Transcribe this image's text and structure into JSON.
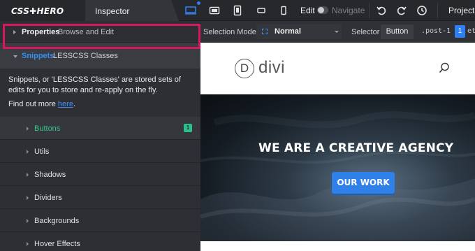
{
  "toolbar": {
    "logo": "CSS✚HERO",
    "tab": "Inspector",
    "edit_label": "Edit",
    "navigate_label": "Navigate",
    "project_label": "Project",
    "icons": [
      "desktop-icon",
      "tablet-landscape-icon",
      "tablet-portrait-icon",
      "phone-landscape-icon",
      "phone-portrait-icon",
      "undo-icon",
      "redo-icon",
      "history-icon"
    ],
    "accent": "#2f7ff0"
  },
  "sidebar": {
    "properties": {
      "title": "Properties",
      "subtitle": "Browse and Edit"
    },
    "snippets": {
      "title": "Snippets",
      "subtitle": "LESSCSS Classes",
      "highlight_color": "#d6185f"
    },
    "description": "Snippets, or 'LESSCSS Classes' are stored sets of edits for you to store and re-apply on the fly.",
    "findout_prefix": "Find out more ",
    "findout_link": "here",
    "findout_suffix": ".",
    "categories": [
      {
        "label": "Buttons",
        "badge": "1",
        "active": true
      },
      {
        "label": "Utils"
      },
      {
        "label": "Shadows"
      },
      {
        "label": "Dividers"
      },
      {
        "label": "Backgrounds"
      },
      {
        "label": "Hover Effects"
      }
    ]
  },
  "selection_bar": {
    "mode_label": "Selection Mode",
    "mode_value": "Normal",
    "selector_label": "Selector",
    "selector_button": "Button",
    "selector_path": ".post-1",
    "selector_count": "1",
    "selector_tail": "et"
  },
  "preview": {
    "logo_letter": "D",
    "logo_word": "divi",
    "hero_title": "WE ARE A CREATIVE AGENCY",
    "hero_button": "OUR WORK"
  }
}
